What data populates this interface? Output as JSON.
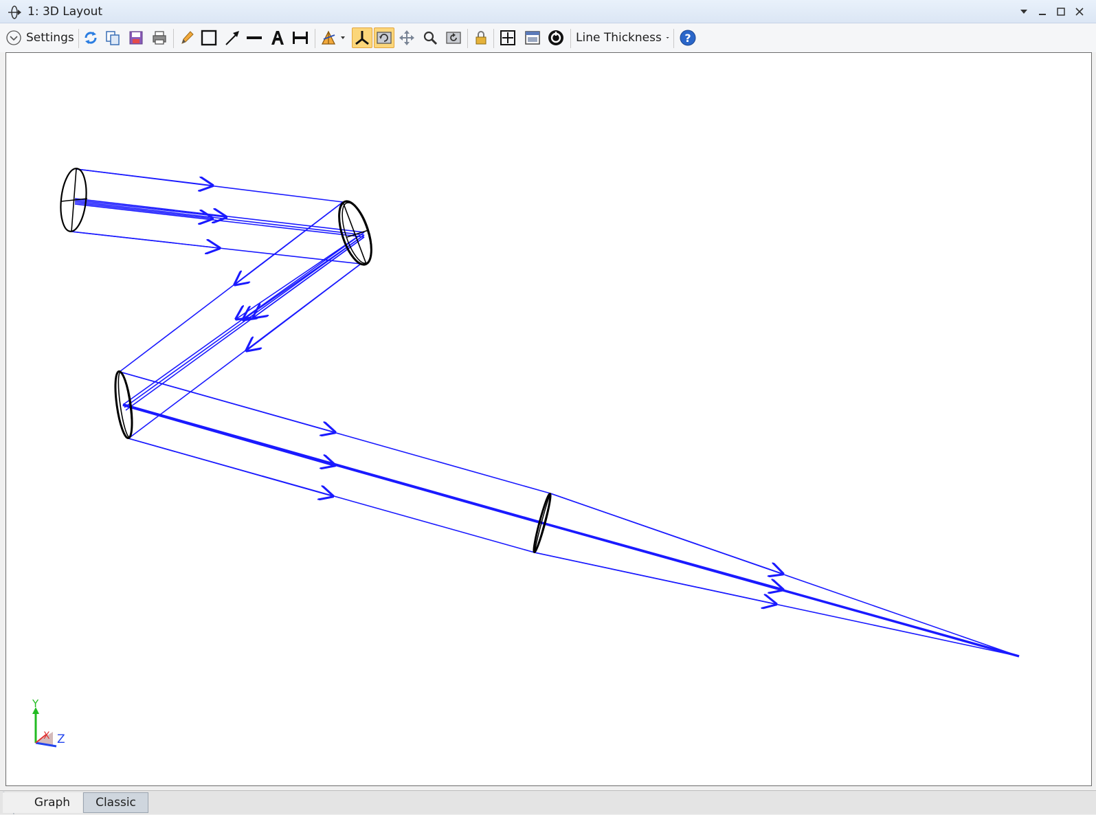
{
  "window": {
    "title": "1: 3D Layout"
  },
  "toolbar": {
    "settings_label": "Settings",
    "line_thickness_label": "Line Thickness",
    "tools": [
      "refresh-icon",
      "copy-icon",
      "save-icon",
      "print-icon",
      "pencil-icon",
      "rectangle-icon",
      "arrow-icon",
      "line-icon",
      "text-icon",
      "dimension-icon",
      "rotate-icon",
      "axes-icon",
      "autoscale-icon",
      "pan-icon",
      "zoom-icon",
      "reset-view-icon",
      "lock-icon",
      "fit-icon",
      "window-icon",
      "snapshot-icon",
      "help-icon"
    ]
  },
  "axis_triad": {
    "y_label": "Y",
    "x_label": "X",
    "z_label": "Z",
    "colors": {
      "y": "#22bb22",
      "x": "#dd3333",
      "z": "#2244ee"
    }
  },
  "colors": {
    "ray": "#1a1aff",
    "surface": "#000000",
    "toggle_bg": "#fbd67a"
  },
  "tabs": [
    {
      "label": "Graph",
      "active": true
    },
    {
      "label": "Classic",
      "active": false
    }
  ]
}
